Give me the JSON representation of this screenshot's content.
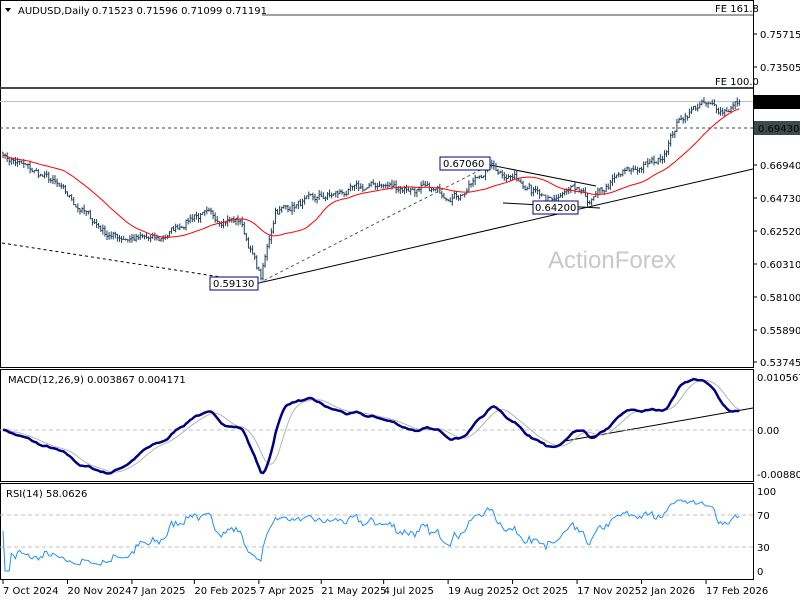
{
  "header": {
    "symbol_label": "AUDUSD,Daily",
    "ohlc": "0.71523 0.71596 0.71099 0.71191"
  },
  "watermark": "ActionForex",
  "colors": {
    "bars": "#1f3f5a",
    "ma": "#ff0000",
    "macd": "#000080",
    "signal": "#b4b4b4",
    "rsi": "#1e90ff"
  },
  "annotations": {
    "fe_161": "FE 161.8",
    "fe_100": "FE 100.0",
    "high_label": "0.67060",
    "low_label_2": "0.64200",
    "low_label_1": "0.59130",
    "bid_tag": "0.71191",
    "level_tag": "0.69430"
  },
  "macd": {
    "title": "MACD(12,26,9) 0.003867 0.004171",
    "ticks": [
      "0.010567",
      "0.00",
      "-0.008808"
    ]
  },
  "rsi": {
    "title": "RSI(14) 58.0626",
    "ticks": [
      "100",
      "70",
      "30",
      "0"
    ]
  },
  "chart_data": {
    "type": "line",
    "title": "AUDUSD,Daily",
    "price_ticks": [
      "0.75715",
      "0.73505",
      "0.71191",
      "0.69430",
      "0.66940",
      "0.64730",
      "0.62520",
      "0.60310",
      "0.58100",
      "0.55890",
      "0.53745"
    ],
    "ylim": [
      0.53745,
      0.75715
    ],
    "x_labels": [
      "7 Oct 2024",
      "20 Nov 2024",
      "7 Jan 2025",
      "20 Feb 2025",
      "7 Apr 2025",
      "21 May 2025",
      "4 Jul 2025",
      "19 Aug 2025",
      "2 Oct 2025",
      "17 Nov 2025",
      "2 Jan 2026",
      "17 Feb 2026"
    ],
    "x_label_bars": [
      0,
      31,
      62,
      92,
      123,
      153,
      183,
      214,
      245,
      276,
      307,
      338
    ],
    "bar_count": 355,
    "close_anchors": [
      [
        0,
        0.676
      ],
      [
        23,
        0.659
      ],
      [
        51,
        0.622
      ],
      [
        75,
        0.619
      ],
      [
        92,
        0.636
      ],
      [
        114,
        0.632
      ],
      [
        124,
        0.5935
      ],
      [
        131,
        0.639
      ],
      [
        157,
        0.649
      ],
      [
        181,
        0.656
      ],
      [
        200,
        0.653
      ],
      [
        220,
        0.649
      ],
      [
        234,
        0.669
      ],
      [
        253,
        0.656
      ],
      [
        261,
        0.644
      ],
      [
        275,
        0.653
      ],
      [
        282,
        0.644
      ],
      [
        297,
        0.663
      ],
      [
        316,
        0.673
      ],
      [
        325,
        0.7
      ],
      [
        335,
        0.71
      ],
      [
        347,
        0.706
      ],
      [
        354,
        0.71191
      ]
    ],
    "levels": {
      "fe_161_8": 0.7615,
      "fe_100": 0.727,
      "last": 0.71191,
      "support": 0.6943,
      "high": 0.6706,
      "low2": 0.642,
      "low1": 0.5913
    },
    "macd_range": [
      -0.008808,
      0.010567
    ],
    "rsi_range": [
      0,
      100
    ]
  }
}
